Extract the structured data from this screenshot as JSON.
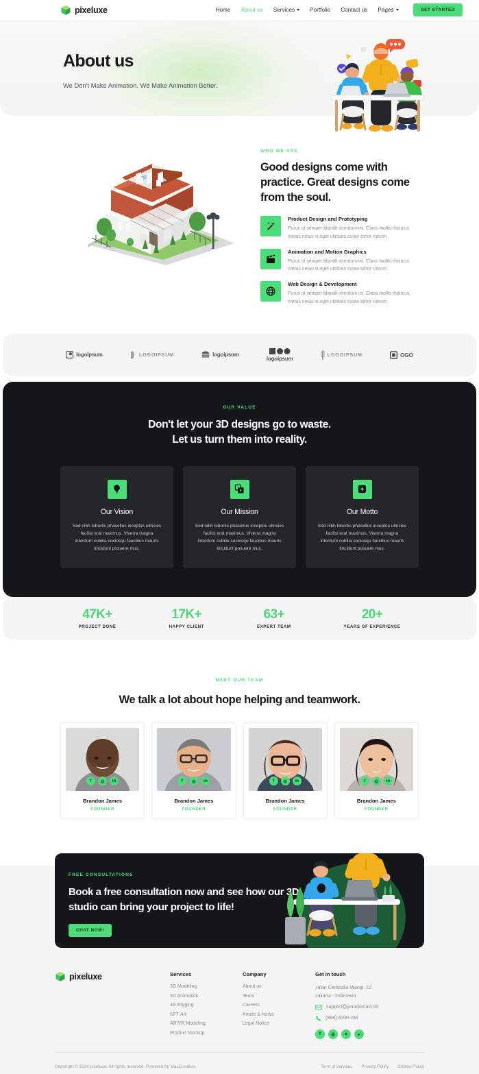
{
  "brand": {
    "name": "pixeluxe",
    "logo_icon": "green-cube-logo",
    "accent": "#4ddc7a",
    "dark": "#13171a"
  },
  "header": {
    "nav": [
      {
        "label": "Home",
        "active": false,
        "caret": false
      },
      {
        "label": "About us",
        "active": true,
        "caret": false
      },
      {
        "label": "Services",
        "active": false,
        "caret": true
      },
      {
        "label": "Portfolio",
        "active": false,
        "caret": false
      },
      {
        "label": "Contact us",
        "active": false,
        "caret": false
      },
      {
        "label": "Pages",
        "active": false,
        "caret": true
      }
    ],
    "cta_label": "GET STARTED"
  },
  "hero": {
    "title": "About us",
    "subtitle": "We Don't Make Animation. We Make Animation Better.",
    "art_name": "3d-team-at-desk-illustration"
  },
  "who": {
    "image_name": "3d-house-render",
    "eyebrow": "WHO WE ARE",
    "heading": "Good designs come with practice. Great designs come from the soul.",
    "features": [
      {
        "icon": "wand-sparkle-icon",
        "title": "Product Design and Prototyping",
        "text": "Purus id semper blandit interdum mi. Class mollis rhoncus metus netus si eget ultricies curae tortor rutrum."
      },
      {
        "icon": "clapperboard-icon",
        "title": "Animation and Motion Graphics",
        "text": "Purus id semper blandit interdum mi. Class mollis rhoncus metus netus si eget ultricies curae tortor rutrum."
      },
      {
        "icon": "globe-icon",
        "title": "Web Design & Development",
        "text": "Purus id semper blandit interdum mi. Class mollis rhoncus metus netus si eget ultricies curae tortor rutrum."
      }
    ]
  },
  "logos": [
    {
      "name": "logoipsum-1",
      "text": "logoipsum",
      "style": "bold"
    },
    {
      "name": "logoipsum-2",
      "text": "LOGOIPSUM",
      "style": "spaced"
    },
    {
      "name": "logoipsum-3",
      "text": "logoipsum",
      "style": "bold"
    },
    {
      "name": "logoipsum-4",
      "text": "logoipsum",
      "style": "stacked"
    },
    {
      "name": "logoipsum-5",
      "text": "LOGOIPSUM",
      "style": "spaced"
    },
    {
      "name": "logo-6",
      "text": "OGO",
      "style": "large"
    }
  ],
  "value": {
    "eyebrow": "OUR VALUE",
    "heading_line1": "Don't let your 3D designs go to waste.",
    "heading_line2": "Let us turn them into reality.",
    "cards": [
      {
        "icon": "lightbulb-icon",
        "title": "Our Vision",
        "text": "Sed nibh lobortis phasellus inceptos ultricies facilisi erat maximus. Viverra magna interdum cubilia sociosqu faucibus mauris tincidunt posuere mus."
      },
      {
        "icon": "video-layers-icon",
        "title": "Our Mission",
        "text": "Sed nibh lobortis phasellus inceptos ultricies facilisi erat maximus. Viverra magna interdum cubilia sociosqu faucibus mauris tincidunt posuere mus."
      },
      {
        "icon": "plus-badge-icon",
        "title": "Our Motto",
        "text": "Sed nibh lobortis phasellus inceptos ultricies facilisi erat maximus. Viverra magna interdum cubilia sociosqu faucibus mauris tincidunt posuere mus."
      }
    ]
  },
  "stats": [
    {
      "value": "47K+",
      "label": "PROJECT DONE"
    },
    {
      "value": "17K+",
      "label": "HAPPY CLIENT"
    },
    {
      "value": "63+",
      "label": "EXPERT TEAM"
    },
    {
      "value": "20+",
      "label": "YEARS OF EXPERIENCE"
    }
  ],
  "team": {
    "eyebrow": "MEET OUR TEAM",
    "heading": "We talk a lot about hope helping and teamwork.",
    "socials": [
      "facebook-icon",
      "instagram-icon",
      "linkedin-icon"
    ],
    "members": [
      {
        "photo": "portrait-man-smiling",
        "name": "Brandon James",
        "role": "FOUNDER"
      },
      {
        "photo": "portrait-man-glasses",
        "name": "Brandon James",
        "role": "FOUNDER"
      },
      {
        "photo": "portrait-woman-glasses",
        "name": "Brandon James",
        "role": "FOUNDER"
      },
      {
        "photo": "portrait-woman-dark-hair",
        "name": "Brandon James",
        "role": "FOUNDER"
      }
    ]
  },
  "cta": {
    "eyebrow": "FREE CONSULTATIONS",
    "heading": "Book a free consultation now and see how our 3D studio can bring your project to life!",
    "button": "CHAT NOW!",
    "art_name": "3d-consultation-illustration"
  },
  "footer": {
    "services": {
      "title": "Services",
      "links": [
        "3D Modeling",
        "3D Animation",
        "3D Rigging",
        "NFT Art",
        "AR/VR Modeling",
        "Product Mockup"
      ]
    },
    "company": {
      "title": "Company",
      "links": [
        "About us",
        "Team",
        "Careers",
        "Article & News",
        "Legal Notice"
      ]
    },
    "contact": {
      "title": "Get in touch",
      "address_line1": "Jalan Cempaka Wangi, 22",
      "address_line2": "Jakarta - Indonesia",
      "email": "support@yourdomain.tld",
      "phone": "(888) 4000-234",
      "socials": [
        "facebook-icon",
        "instagram-icon",
        "twitter-icon",
        "youtube-icon"
      ]
    },
    "copyright": "Copyright © 2024 pixeluxe, All rights reserved. Powered by MaxCreative.",
    "legal": [
      "Term of services",
      "Privacy Policy",
      "Cookie Policy"
    ]
  }
}
